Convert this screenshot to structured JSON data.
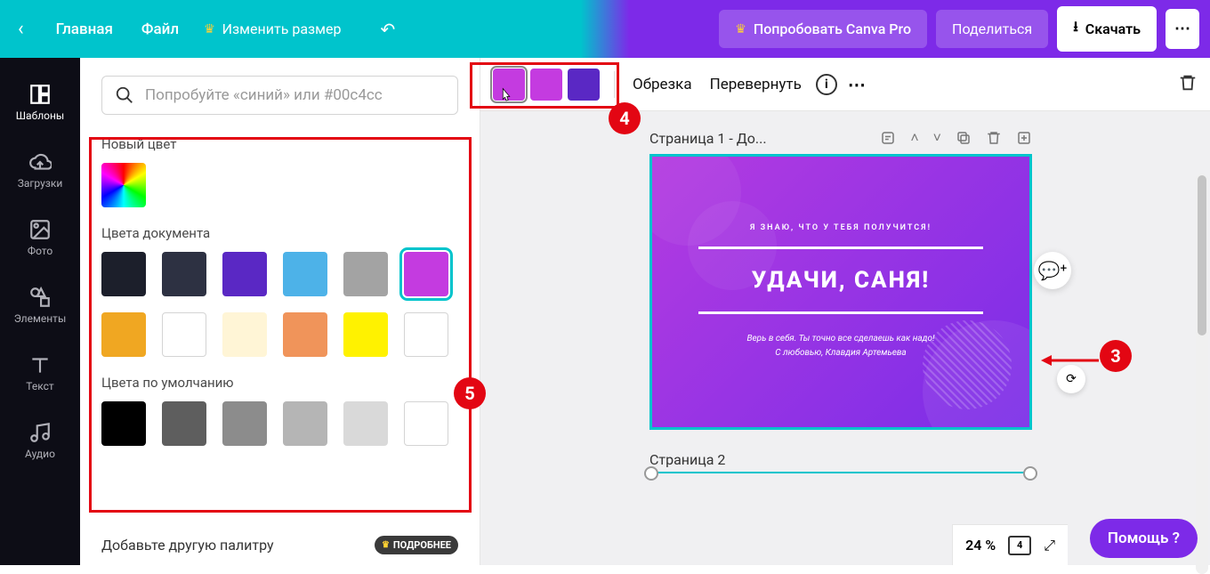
{
  "topbar": {
    "home": "Главная",
    "file": "Файл",
    "resize": "Изменить размер",
    "pro": "Попробовать Canva Pro",
    "share": "Поделиться",
    "download": "Скачать"
  },
  "sidebar": {
    "templates": "Шаблоны",
    "uploads": "Загрузки",
    "photos": "Фото",
    "elements": "Элементы",
    "text": "Текст",
    "audio": "Аудио"
  },
  "panel": {
    "search_placeholder": "Попробуйте «синий» или #00c4cc",
    "new_color": "Новый цвет",
    "doc_colors_title": "Цвета документа",
    "doc_colors": [
      "#1c1f2b",
      "#2d3142",
      "#5a28c4",
      "#4db2e8",
      "#a3a3a3",
      "#c43be0",
      "#f0a722",
      "#ffffff",
      "#fff5d6",
      "#f0945a",
      "#fff200",
      "#ffffff"
    ],
    "doc_selected_index": 5,
    "default_colors_title": "Цвета по умолчанию",
    "default_colors": [
      "#000000",
      "#5e5e5e",
      "#8c8c8c",
      "#b5b5b5",
      "#d9d9d9",
      "#ffffff"
    ],
    "add_palette": "Добавьте другую палитру",
    "more_badge": "ПОДРОБНЕЕ"
  },
  "context": {
    "chips": [
      "#c43be0",
      "#c43be0",
      "#5a28c4"
    ],
    "crop": "Обрезка",
    "flip": "Перевернуть"
  },
  "page": {
    "title": "Страница 1 - До...",
    "page2": "Страница 2",
    "card": {
      "small": "Я ЗНАЮ, ЧТО У ТЕБЯ ПОЛУЧИТСЯ!",
      "big": "УДАЧИ, САНЯ!",
      "sub1": "Верь в себя. Ты точно все сделаешь как надо!",
      "sub2": "С любовью, Клавдия Артемьева"
    }
  },
  "bottom": {
    "zoom": "24 %",
    "pages": "4"
  },
  "help": "Помощь  ?",
  "annotations": {
    "n3": "3",
    "n4": "4",
    "n5": "5"
  }
}
